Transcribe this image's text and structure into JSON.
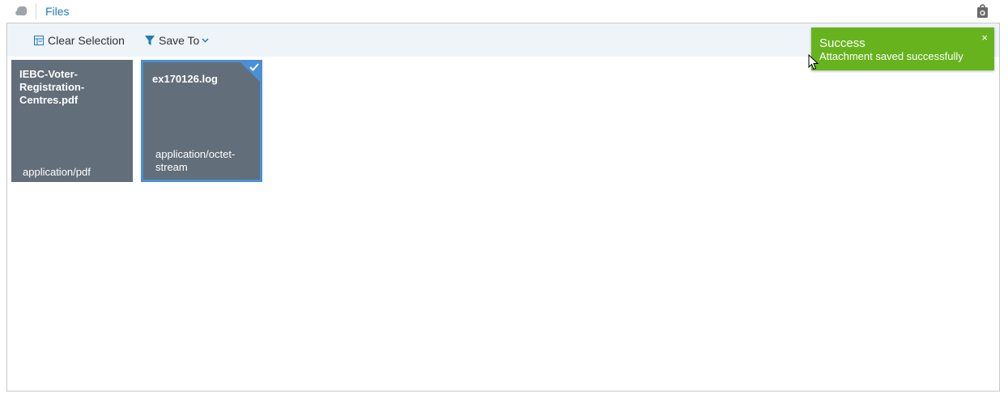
{
  "header": {
    "title": "Files",
    "app_icon": "app-logo-icon",
    "right_icon": "shopping-bag-icon"
  },
  "toolbar": {
    "clear_label": "Clear Selection",
    "save_label": "Save To",
    "clear_icon": "clear-selection-icon",
    "save_icon": "filter-icon"
  },
  "files": [
    {
      "name": "IEBC-Voter-Registration-Centres.pdf",
      "type": "application/pdf",
      "selected": false
    },
    {
      "name": "ex170126.log",
      "type": "application/octet-stream",
      "selected": true
    }
  ],
  "toast": {
    "title": "Success",
    "message": "Attachment saved successfully",
    "close": "×",
    "color": "#67b31e"
  },
  "colors": {
    "accent": "#1e7ab8",
    "tile": "#626e7a",
    "selected_border": "#4a90d4"
  }
}
